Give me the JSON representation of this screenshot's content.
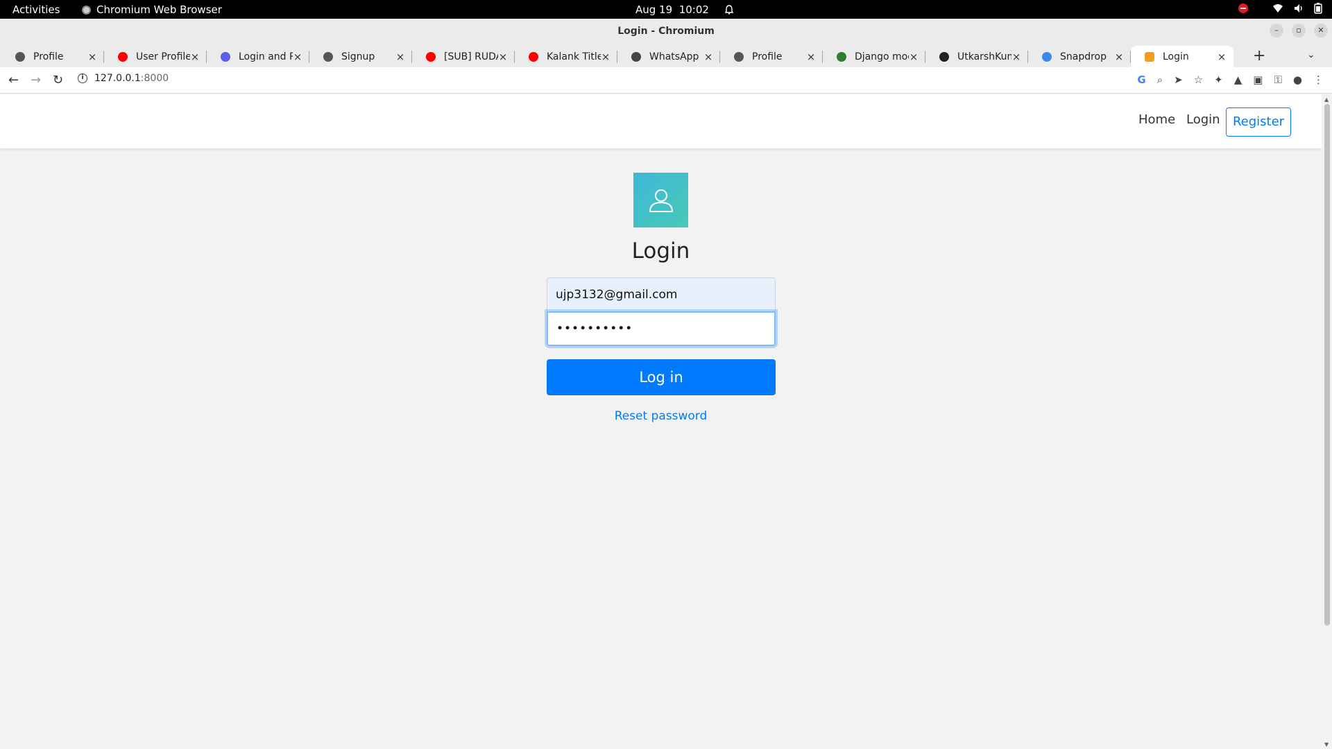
{
  "os": {
    "activities": "Activities",
    "app_name": "Chromium Web Browser",
    "date": "Aug 19",
    "time": "10:02"
  },
  "window": {
    "title": "Login - Chromium"
  },
  "tabs": [
    {
      "label": "Profile",
      "icon": "globe-icon",
      "color": "#555555"
    },
    {
      "label": "User Profile",
      "icon": "youtube-icon",
      "color": "#ff0000"
    },
    {
      "label": "Login and Re",
      "icon": "cl-icon",
      "color": "#5b5fe8"
    },
    {
      "label": "Signup",
      "icon": "globe-icon",
      "color": "#555555"
    },
    {
      "label": "[SUB] RUDA",
      "icon": "youtube-icon",
      "color": "#ff0000"
    },
    {
      "label": "Kalank Title",
      "icon": "youtube-icon",
      "color": "#ff0000"
    },
    {
      "label": "WhatsApp",
      "icon": "folder-icon",
      "color": "#444444"
    },
    {
      "label": "Profile",
      "icon": "globe-icon",
      "color": "#555555"
    },
    {
      "label": "Django mod",
      "icon": "django-icon",
      "color": "#2e7d32"
    },
    {
      "label": "UtkarshKum",
      "icon": "github-icon",
      "color": "#222222"
    },
    {
      "label": "Snapdrop",
      "icon": "snapdrop-icon",
      "color": "#3f88e8"
    },
    {
      "label": "Login",
      "icon": "page-icon",
      "color": "#f0a020",
      "active": true
    }
  ],
  "address": {
    "host": "127.0.0.1",
    "port": ":8000"
  },
  "site_nav": {
    "home": "Home",
    "login": "Login",
    "register": "Register"
  },
  "login_form": {
    "title": "Login",
    "email_value": "ujp3132@gmail.com",
    "password_value": "••••••••••",
    "submit_label": "Log in",
    "reset_link": "Reset password"
  },
  "colors": {
    "primary": "#007bff",
    "avatar_bg": "#42c0c8"
  }
}
